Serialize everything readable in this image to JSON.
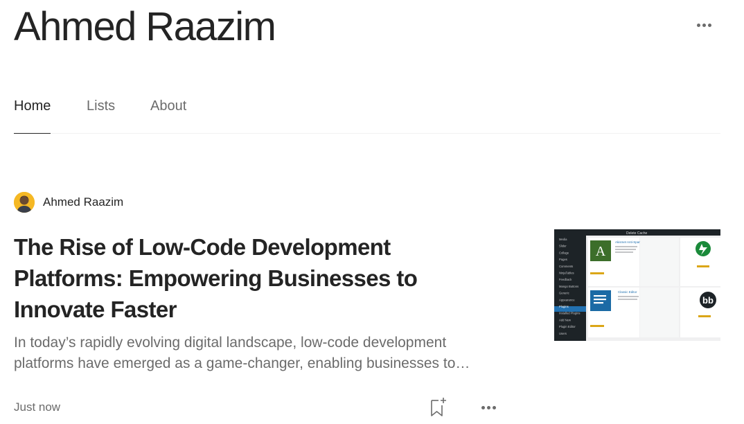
{
  "profile": {
    "name": "Ahmed Raazim",
    "more_icon": "more-horizontal-icon"
  },
  "tabs": [
    {
      "label": "Home",
      "active": true
    },
    {
      "label": "Lists",
      "active": false
    },
    {
      "label": "About",
      "active": false
    }
  ],
  "post": {
    "author": "Ahmed Raazim",
    "title": "The Rise of Low-Code Development Platforms: Empowering Businesses to Innovate Faster",
    "excerpt": "In today’s rapidly evolving digital landscape, low-code development platforms have emerged as a game-changer, enabling businesses to innovate faster.",
    "time": "Just now",
    "save_icon": "bookmark-add-icon",
    "more_icon": "more-horizontal-icon"
  },
  "thumbnail": {
    "admin_menu": [
      "Media",
      "Slider",
      "Collage",
      "Pages",
      "Comments",
      "NinjaTables",
      "Feedback",
      "Mango Buttons",
      "Generic",
      "Appearance",
      "Plugins",
      "Installed Plugins",
      "Add New",
      "Plugin Editor",
      "Users"
    ],
    "plugin_1": "Akismet Anti-Spam",
    "plugin_2": "Classic Editor",
    "top_bar": "Delete Cache"
  },
  "colors": {
    "text": "#242424",
    "muted": "#6b6b6b",
    "divider": "#f2f2f2",
    "avatar_bg": "#f5b824"
  }
}
